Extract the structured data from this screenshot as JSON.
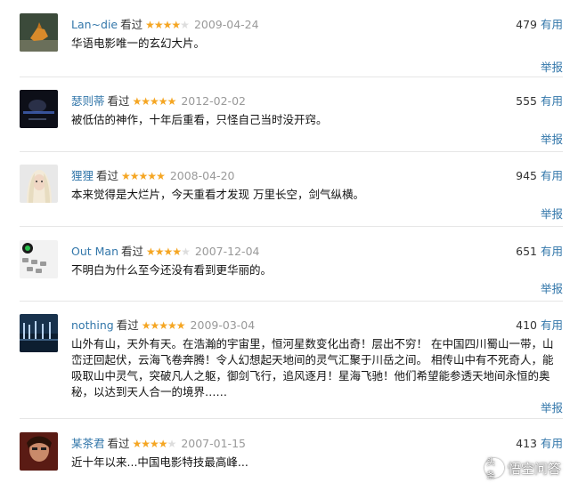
{
  "comments": [
    {
      "user": "Lan~die",
      "status": "看过",
      "stars": "★★★★",
      "stars_empty": "★",
      "date": "2009-04-24",
      "useful_count": "479",
      "useful_label": "有用",
      "text": "华语电影唯一的玄幻大片。",
      "report": "举报"
    },
    {
      "user": "瑟则蒂",
      "status": "看过",
      "stars": "★★★★★",
      "stars_empty": "",
      "date": "2012-02-02",
      "useful_count": "555",
      "useful_label": "有用",
      "text": "被低估的神作，十年后重看，只怪自己当时没开窍。",
      "report": "举报"
    },
    {
      "user": "狸狸",
      "status": "看过",
      "stars": "★★★★★",
      "stars_empty": "",
      "date": "2008-04-20",
      "useful_count": "945",
      "useful_label": "有用",
      "text": "本来觉得是大烂片，今天重看才发现 万里长空，剑气纵横。",
      "report": "举报"
    },
    {
      "user": "Out Man",
      "status": "看过",
      "stars": "★★★★",
      "stars_empty": "★",
      "date": "2007-12-04",
      "useful_count": "651",
      "useful_label": "有用",
      "text": "不明白为什么至今还没有看到更华丽的。",
      "report": "举报"
    },
    {
      "user": "nothing",
      "status": "看过",
      "stars": "★★★★★",
      "stars_empty": "",
      "date": "2009-03-04",
      "useful_count": "410",
      "useful_label": "有用",
      "text": "山外有山，天外有天。在浩瀚的宇宙里，恒河星数变化出奇！层出不穷！ 在中国四川蜀山一带，山峦迂回起伏，云海飞卷奔腾！令人幻想起天地间的灵气汇聚于川岳之间。 相传山中有不死奇人，能吸取山中灵气，突破凡人之躯，御剑飞行，追风逐月！星海飞驰！他们希望能参透天地间永恒的奥秘，以达到天人合一的境界……",
      "report": "举报"
    },
    {
      "user": "某茶君",
      "status": "看过",
      "stars": "★★★★",
      "stars_empty": "★",
      "date": "2007-01-15",
      "useful_count": "413",
      "useful_label": "有用",
      "text": "近十年以来...中国电影特技最高峰...",
      "report": ""
    }
  ],
  "watermark": {
    "icon": "头条",
    "text": "悟空问答"
  },
  "colors": {
    "link": "#3377aa",
    "star": "#f5a623",
    "date": "#999999"
  }
}
